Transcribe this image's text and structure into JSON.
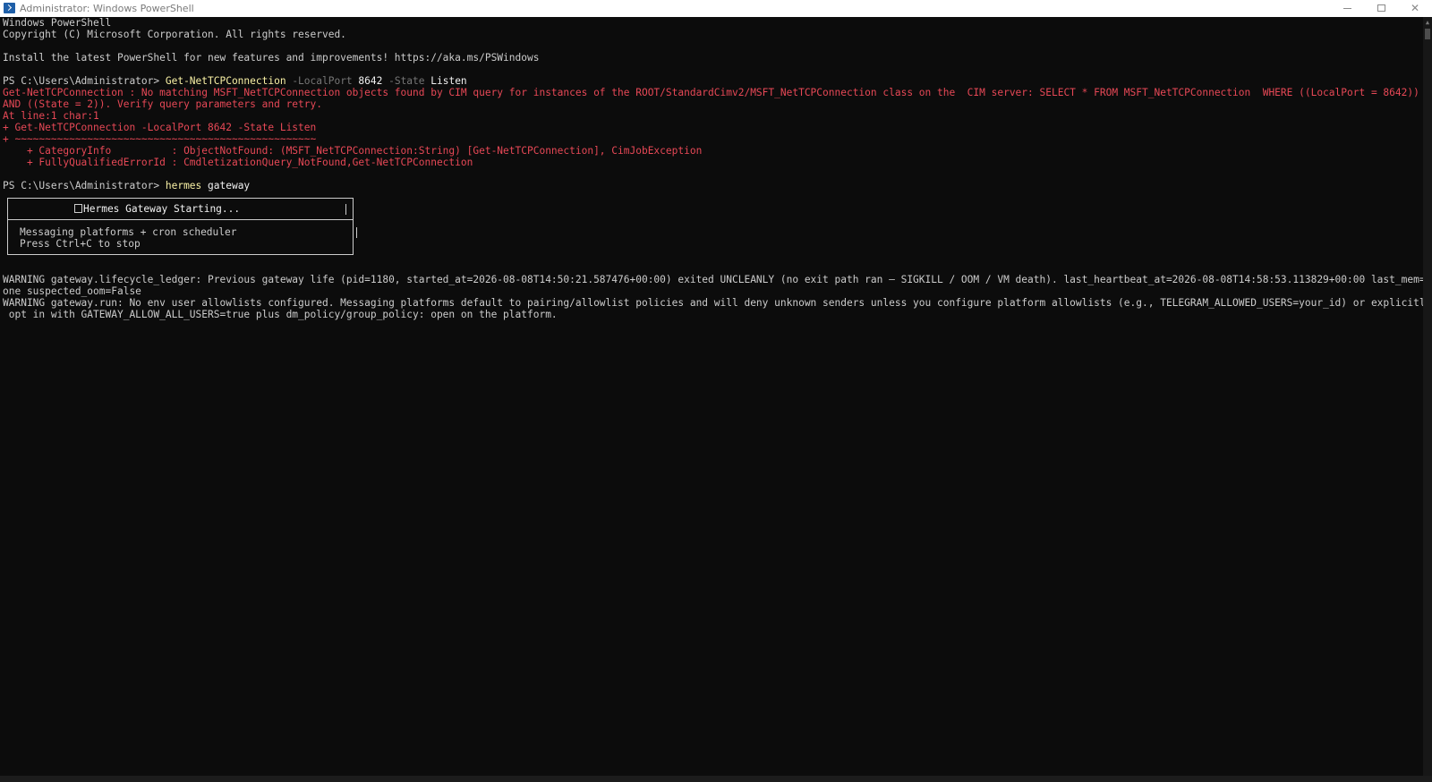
{
  "window": {
    "title": "Administrator: Windows PowerShell",
    "controls": {
      "minimize_icon": "minimize-icon",
      "maximize_icon": "restore-icon",
      "close_icon": "close-icon",
      "close_glyph": "✕"
    }
  },
  "console": {
    "header": [
      "Windows PowerShell",
      "Copyright (C) Microsoft Corporation. All rights reserved.",
      "Install the latest PowerShell for new features and improvements! https://aka.ms/PSWindows"
    ],
    "command1": {
      "prompt": "PS C:\\Users\\Administrator> ",
      "cmdlet": "Get-NetTCPConnection",
      "p1": " -LocalPort",
      "v1": " 8642",
      "p2": " -State",
      "v2": " Listen"
    },
    "error": [
      "Get-NetTCPConnection : No matching MSFT_NetTCPConnection objects found by CIM query for instances of the ROOT/StandardCimv2/MSFT_NetTCPConnection class on the  CIM server: SELECT * FROM MSFT_NetTCPConnection  WHERE ((LocalPort = 8642))",
      "AND ((State = 2)). Verify query parameters and retry.",
      "At line:1 char:1",
      "+ Get-NetTCPConnection -LocalPort 8642 -State Listen",
      "+ ~~~~~~~~~~~~~~~~~~~~~~~~~~~~~~~~~~~~~~~~~~~~~~~~~~",
      "    + CategoryInfo          : ObjectNotFound: (MSFT_NetTCPConnection:String) [Get-NetTCPConnection], CimJobException",
      "    + FullyQualifiedErrorId : CmdletizationQuery_NotFound,Get-NetTCPConnection"
    ],
    "command2": {
      "prompt": "PS C:\\Users\\Administrator> ",
      "cmd": "hermes",
      "arg": " gateway"
    },
    "banner": {
      "title": "Hermes Gateway Starting...",
      "lines": [
        "Messaging platforms + cron scheduler",
        "Press Ctrl+C to stop"
      ]
    },
    "warnings": [
      "WARNING gateway.lifecycle_ledger: Previous gateway life (pid=1180, started_at=2026-08-08T14:50:21.587476+00:00) exited UNCLEANLY (no exit path ran — SIGKILL / OOM / VM death). last_heartbeat_at=2026-08-08T14:58:53.113829+00:00 last_mem=N",
      "one suspected_oom=False",
      "WARNING gateway.run: No env user allowlists configured. Messaging platforms default to pairing/allowlist policies and will deny unknown senders unless you configure platform allowlists (e.g., TELEGRAM_ALLOWED_USERS=your_id) or explicitly",
      " opt in with GATEWAY_ALLOW_ALL_USERS=true plus dm_policy/group_policy: open on the platform."
    ]
  },
  "colors": {
    "background": "#0c0c0c",
    "text": "#cccccc",
    "error": "#e74856",
    "command": "#f9f1a5",
    "parameter": "#767676"
  }
}
